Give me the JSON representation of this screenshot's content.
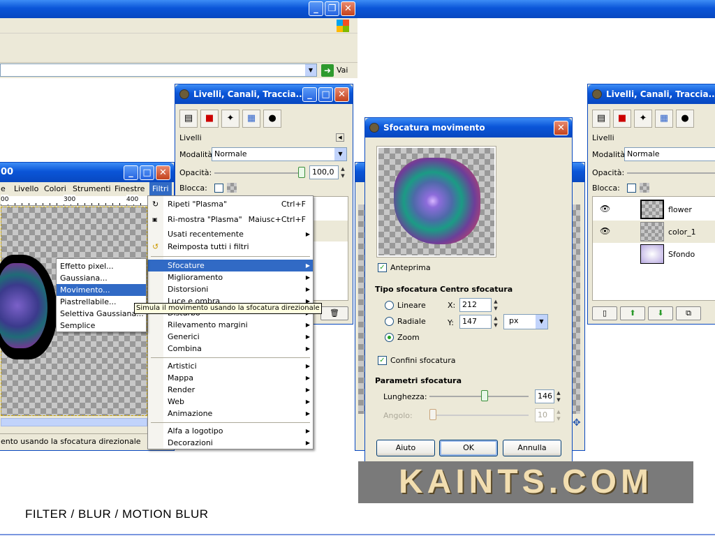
{
  "browser": {
    "go_label": "Vai"
  },
  "image_window": {
    "title_fragment": "00",
    "menubar": [
      "e",
      "Livello",
      "Colori",
      "Strumenti",
      "Finestre",
      "Filtri"
    ],
    "ruler_marks": [
      "00",
      "300",
      "400"
    ],
    "status": "ento usando la sfocatura direzionale"
  },
  "filters_menu": {
    "items": [
      {
        "label": "Ripeti \"Plasma\"",
        "shortcut": "Ctrl+F"
      },
      {
        "label": "Ri-mostra \"Plasma\"",
        "shortcut": "Maiusc+Ctrl+F"
      },
      {
        "label": "Usati recentemente",
        "shortcut": ""
      },
      {
        "label": "Reimposta tutti i filtri",
        "shortcut": ""
      },
      {
        "label": "Sfocature",
        "shortcut": ""
      },
      {
        "label": "Miglioramento",
        "shortcut": ""
      },
      {
        "label": "Distorsioni",
        "shortcut": ""
      },
      {
        "label": "Luce e ombra",
        "shortcut": ""
      },
      {
        "label": "Disturbo",
        "shortcut": ""
      },
      {
        "label": "Rilevamento margini",
        "shortcut": ""
      },
      {
        "label": "Generici",
        "shortcut": ""
      },
      {
        "label": "Combina",
        "shortcut": ""
      },
      {
        "label": "Artistici",
        "shortcut": ""
      },
      {
        "label": "Mappa",
        "shortcut": ""
      },
      {
        "label": "Render",
        "shortcut": ""
      },
      {
        "label": "Web",
        "shortcut": ""
      },
      {
        "label": "Animazione",
        "shortcut": ""
      },
      {
        "label": "Alfa a logotipo",
        "shortcut": ""
      },
      {
        "label": "Decorazioni",
        "shortcut": ""
      }
    ]
  },
  "blur_submenu": {
    "items": [
      "Effetto pixel...",
      "Gaussiana...",
      "Movimento...",
      "Piastrellabile...",
      "Selettiva Gaussiana...",
      "Semplice"
    ]
  },
  "tooltip": "Simula il movimento usando la sfocatura direzionale",
  "layers_dock_left": {
    "title": "Livelli, Canali, Traccia...",
    "tab_label": "Livelli",
    "mode_label": "Modalità:",
    "mode_value": "Normale",
    "opacity_label": "Opacità:",
    "opacity_value": "100,0",
    "lock_label": "Blocca:"
  },
  "layers_dock_right": {
    "title": "Livelli, Canali, Traccia...",
    "tab_label": "Livelli",
    "mode_label": "Modalità:",
    "mode_value": "Normale",
    "opacity_label": "Opacità:",
    "lock_label": "Blocca:",
    "layers": [
      {
        "name": "flower"
      },
      {
        "name": "color_1"
      },
      {
        "name": "Sfondo"
      }
    ]
  },
  "dialog": {
    "title": "Sfocatura movimento",
    "preview_label": "Anteprima",
    "blur_type_heading": "Tipo sfocatura",
    "blur_center_heading": "Centro sfocatura",
    "types": [
      "Lineare",
      "Radiale",
      "Zoom"
    ],
    "selected_type": "Zoom",
    "x_label": "X:",
    "x_value": "212",
    "y_label": "Y:",
    "y_value": "147",
    "unit": "px",
    "edges_label": "Confini sfocatura",
    "params_heading": "Parametri sfocatura",
    "length_label": "Lunghezza:",
    "length_value": "146",
    "angle_label": "Angolo:",
    "angle_value": "10",
    "help_button": "Aiuto",
    "ok_button": "OK",
    "cancel_button": "Annulla"
  },
  "watermark": "KAINTS.COM",
  "caption": "FILTER / BLUR / MOTION BLUR"
}
